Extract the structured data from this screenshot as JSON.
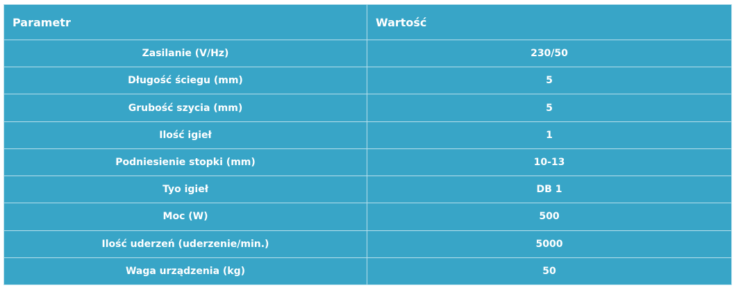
{
  "table": {
    "headers": [
      "Parametr",
      "Wartość"
    ],
    "rows": [
      [
        "Zasilanie (V/Hz)",
        "230/50"
      ],
      [
        "Długość ściegu (mm)",
        "5"
      ],
      [
        "Grubość szycia (mm)",
        "5"
      ],
      [
        "Ilość igieł",
        "1"
      ],
      [
        "Podniesienie stopki (mm)",
        "10-13"
      ],
      [
        "Tyo igieł",
        "DB 1"
      ],
      [
        "Moc (W)",
        "500"
      ],
      [
        "Ilość uderzeń (uderzenie/min.)",
        "5000"
      ],
      [
        "Waga urządzenia (kg)",
        "50"
      ]
    ]
  },
  "colors": {
    "background": "#38a5c7",
    "border": "#b9e0ec",
    "text": "#ffffff"
  }
}
